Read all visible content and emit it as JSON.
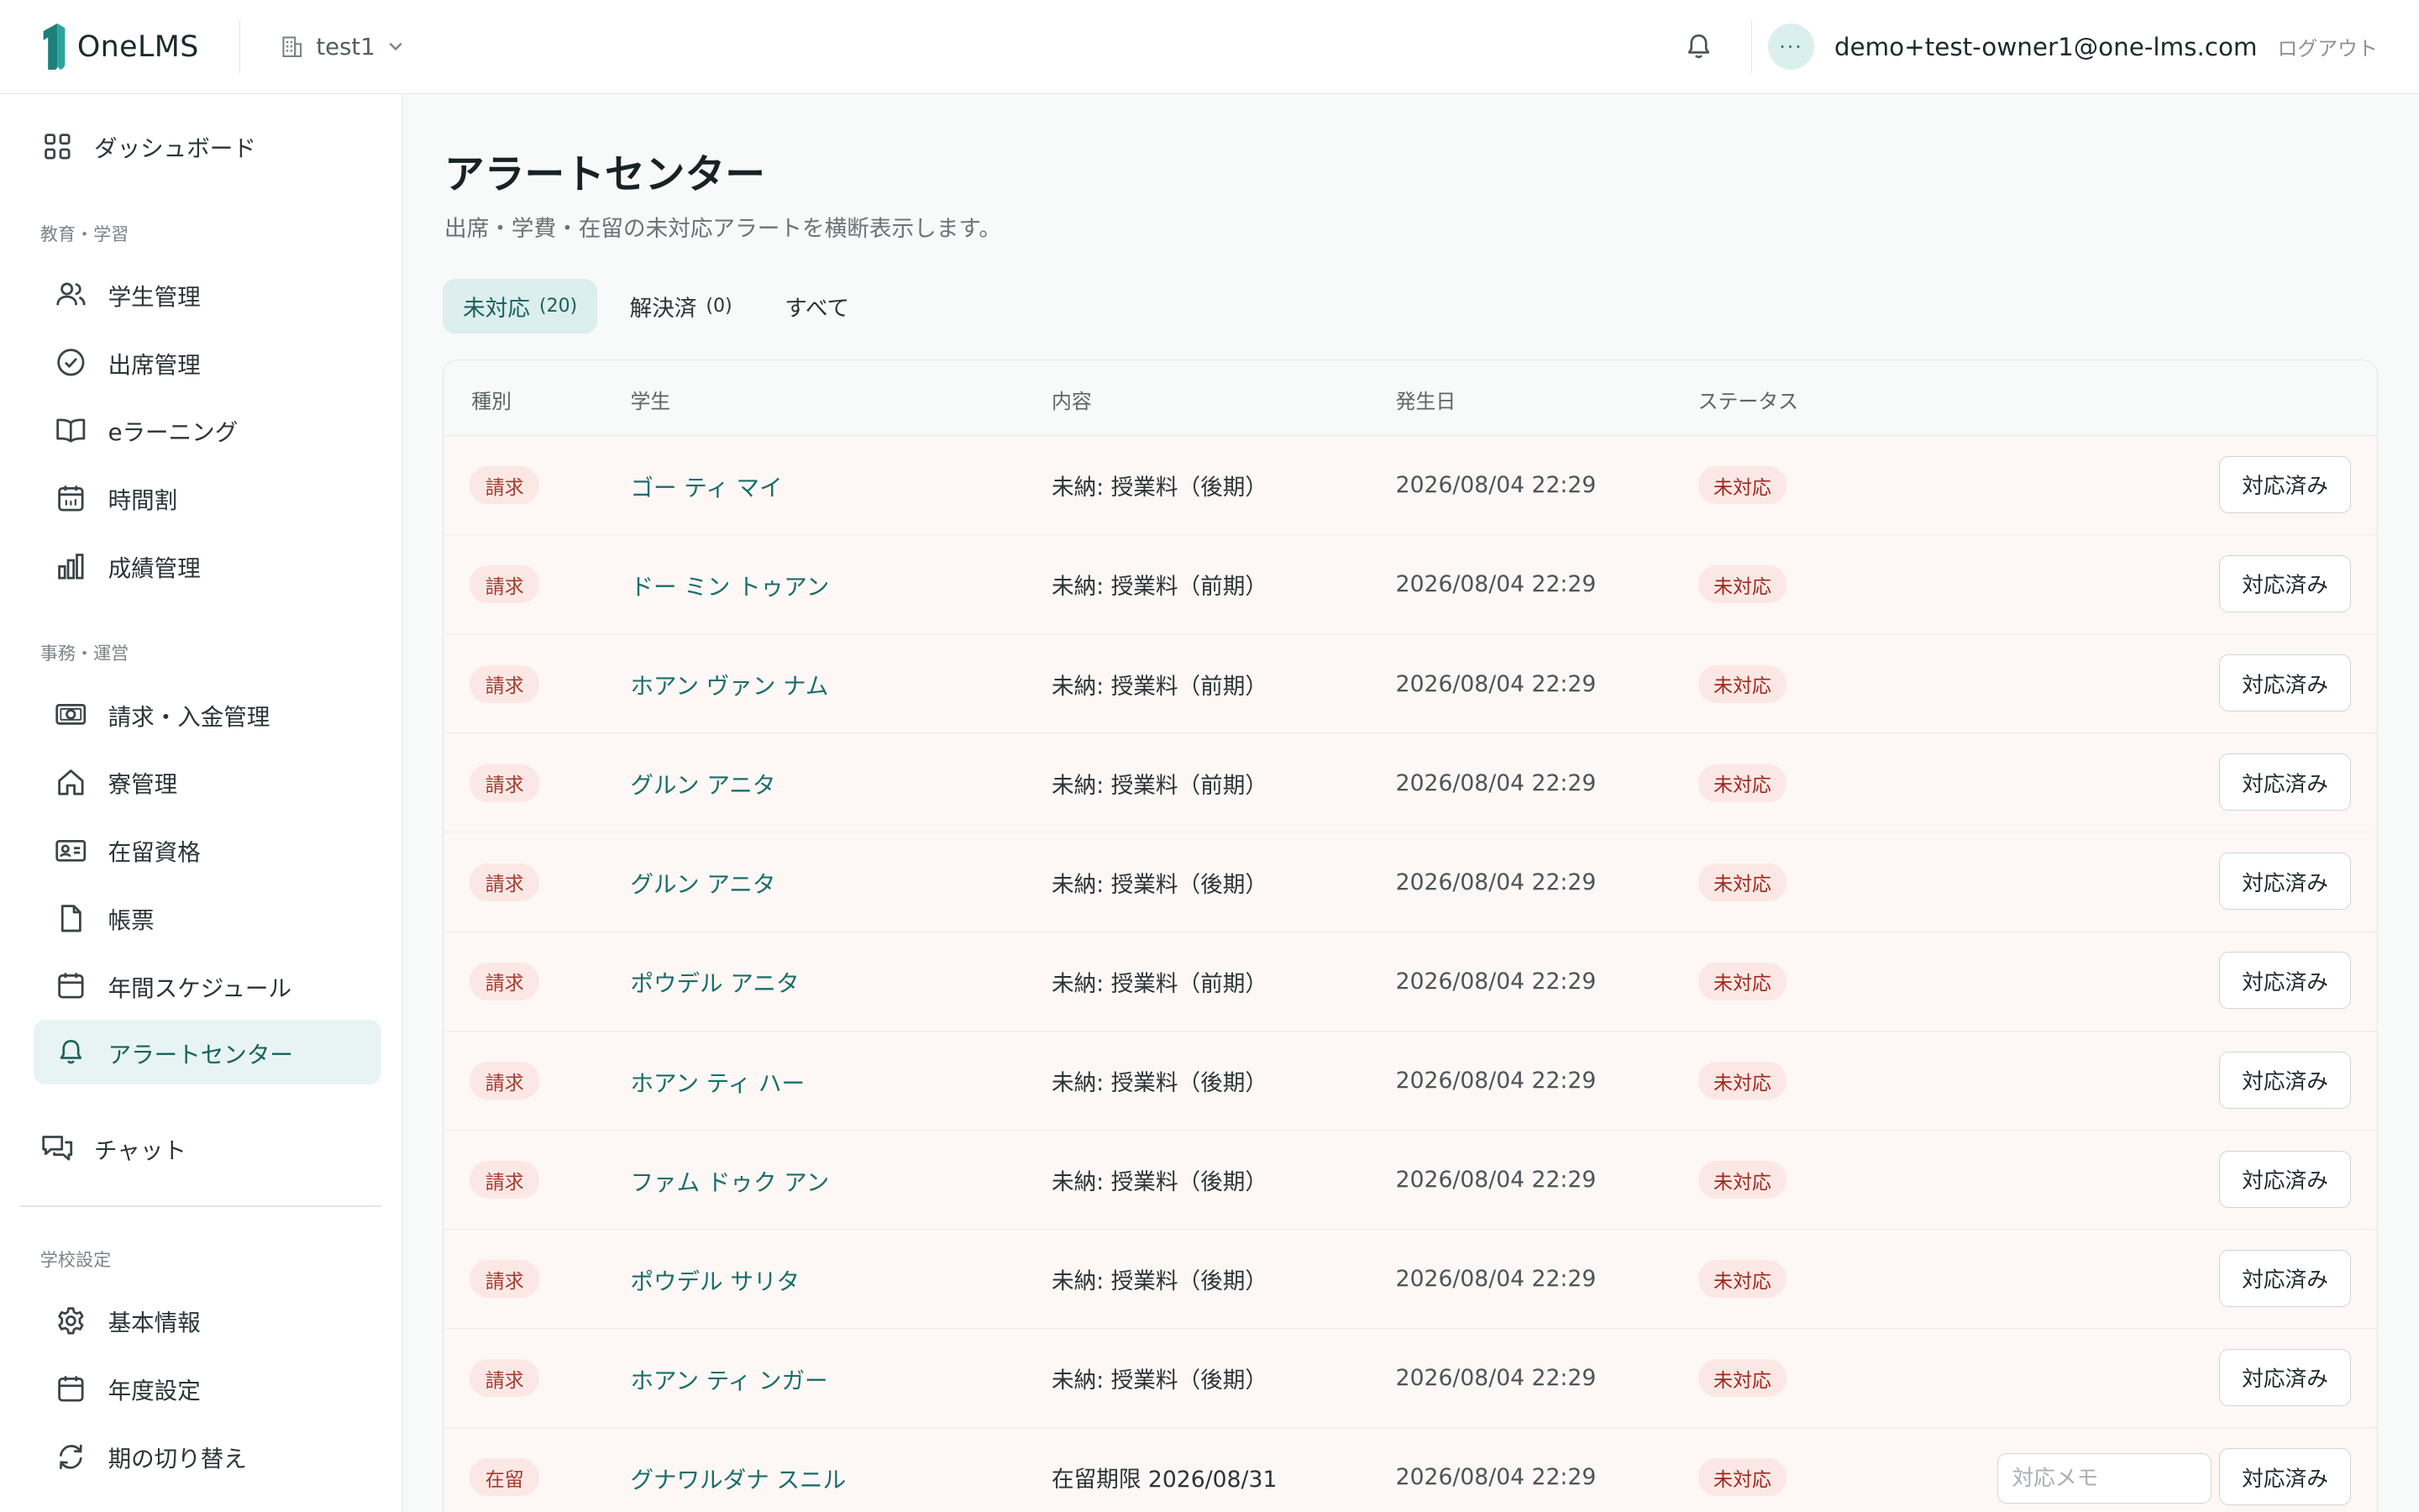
{
  "header": {
    "app_name": "OneLMS",
    "tenant": "test1",
    "avatar_text": "···",
    "user_email": "demo+test-owner1@one-lms.com",
    "logout_label": "ログアウト"
  },
  "sidebar": {
    "dashboard": "ダッシュボード",
    "section_edu": "教育・学習",
    "edu_items": [
      "学生管理",
      "出席管理",
      "eラーニング",
      "時間割",
      "成績管理"
    ],
    "section_admin": "事務・運営",
    "admin_items": [
      "請求・入金管理",
      "寮管理",
      "在留資格",
      "帳票",
      "年間スケジュール",
      "アラートセンター"
    ],
    "chat": "チャット",
    "section_school": "学校設定",
    "school_items": [
      "基本情報",
      "年度設定",
      "期の切り替え"
    ],
    "active_item": "アラートセンター"
  },
  "page": {
    "title": "アラートセンター",
    "subtitle": "出席・学費・在留の未対応アラートを横断表示します。"
  },
  "tabs": [
    {
      "label": "未対応",
      "count": "(20)",
      "active": true
    },
    {
      "label": "解決済",
      "count": "(0)",
      "active": false
    },
    {
      "label": "すべて",
      "count": "",
      "active": false
    }
  ],
  "table": {
    "columns": [
      "種別",
      "学生",
      "内容",
      "発生日",
      "ステータス"
    ],
    "action_label": "対応済み",
    "memo_placeholder": "対応メモ",
    "rows": [
      {
        "type": "請求",
        "student": "ゴー ティ マイ",
        "content": "未納: 授業料（後期）",
        "date": "2026/08/04 22:29",
        "status": "未対応",
        "memo": false
      },
      {
        "type": "請求",
        "student": "ドー ミン トゥアン",
        "content": "未納: 授業料（前期）",
        "date": "2026/08/04 22:29",
        "status": "未対応",
        "memo": false
      },
      {
        "type": "請求",
        "student": "ホアン ヴァン ナム",
        "content": "未納: 授業料（前期）",
        "date": "2026/08/04 22:29",
        "status": "未対応",
        "memo": false
      },
      {
        "type": "請求",
        "student": "グルン アニタ",
        "content": "未納: 授業料（前期）",
        "date": "2026/08/04 22:29",
        "status": "未対応",
        "memo": false
      },
      {
        "type": "請求",
        "student": "グルン アニタ",
        "content": "未納: 授業料（後期）",
        "date": "2026/08/04 22:29",
        "status": "未対応",
        "memo": false
      },
      {
        "type": "請求",
        "student": "ポウデル アニタ",
        "content": "未納: 授業料（前期）",
        "date": "2026/08/04 22:29",
        "status": "未対応",
        "memo": false
      },
      {
        "type": "請求",
        "student": "ホアン ティ ハー",
        "content": "未納: 授業料（後期）",
        "date": "2026/08/04 22:29",
        "status": "未対応",
        "memo": false
      },
      {
        "type": "請求",
        "student": "ファム ドゥク アン",
        "content": "未納: 授業料（後期）",
        "date": "2026/08/04 22:29",
        "status": "未対応",
        "memo": false
      },
      {
        "type": "請求",
        "student": "ポウデル サリタ",
        "content": "未納: 授業料（後期）",
        "date": "2026/08/04 22:29",
        "status": "未対応",
        "memo": false
      },
      {
        "type": "請求",
        "student": "ホアン ティ ンガー",
        "content": "未納: 授業料（後期）",
        "date": "2026/08/04 22:29",
        "status": "未対応",
        "memo": false
      },
      {
        "type": "在留",
        "student": "グナワルダナ スニル",
        "content": "在留期限 2026/08/31",
        "date": "2026/08/04 22:29",
        "status": "未対応",
        "memo": true
      }
    ]
  },
  "colors": {
    "accent": "#16615d",
    "link": "#1a6e69",
    "alert_badge": "#a0261d",
    "row_tint": "#fdf7f6"
  }
}
